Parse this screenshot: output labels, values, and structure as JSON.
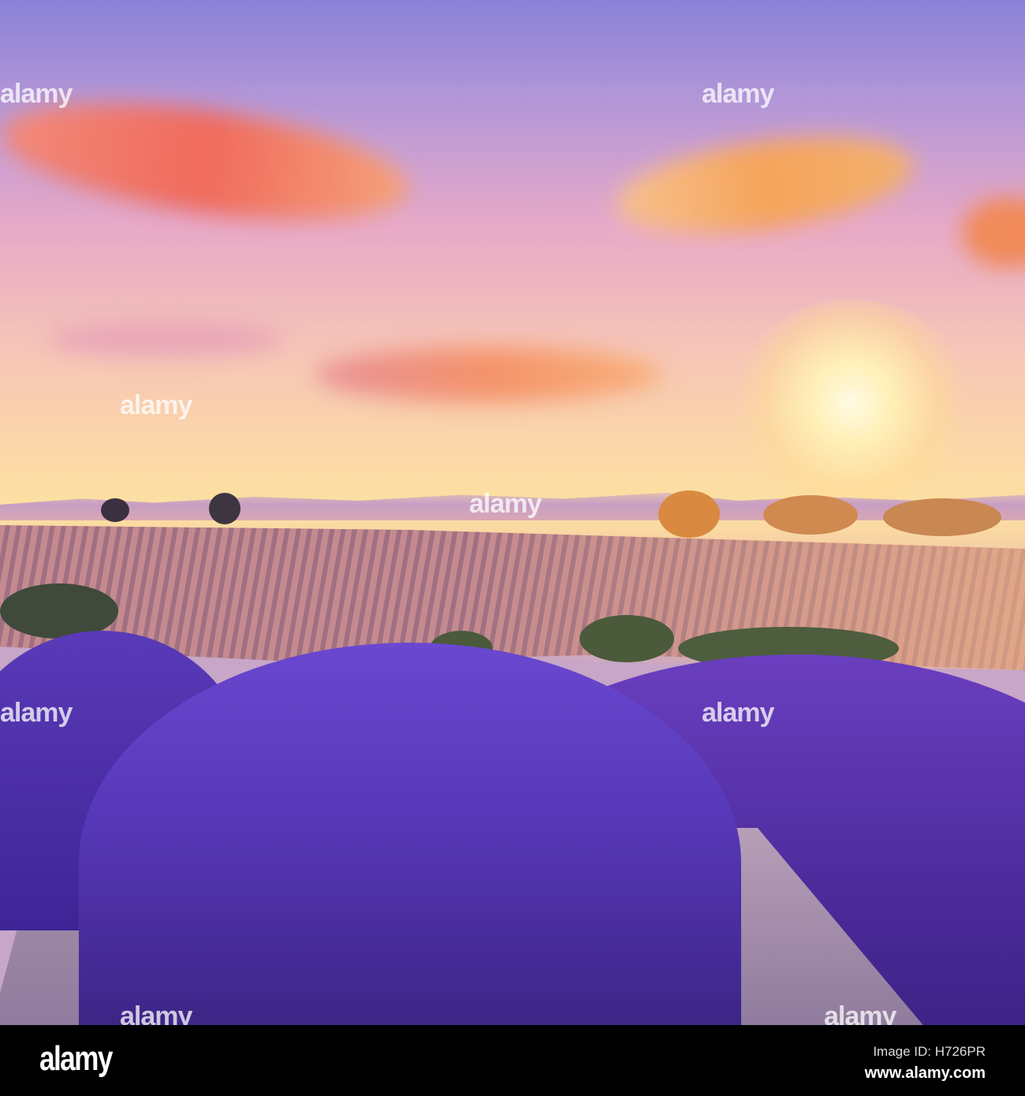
{
  "photo": {
    "watermark_text": "alamy"
  },
  "footer": {
    "logo": "alamy",
    "image_id": "Image ID: H726PR",
    "url": "www.alamy.com"
  }
}
